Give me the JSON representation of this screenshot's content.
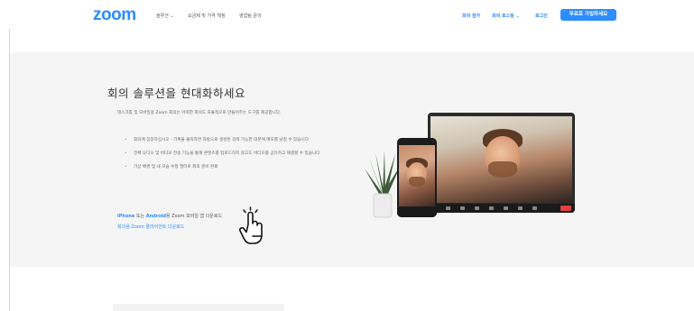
{
  "header": {
    "logo": "zoom",
    "nav": [
      "솔루션 ⌄",
      "요금제 및 가격 책정",
      "영업팀 문의"
    ],
    "nav_right": [
      "회의 참가",
      "회의 호스팅 ⌄",
      "로그인"
    ],
    "signup": "무료로 가입하세요"
  },
  "hero": {
    "title": "회의 솔루션을 현대화하세요",
    "description": "데스크톱 및 모바일용 Zoom 회의는 어떠한 회의도 효율적으로 만들어주는 도구를 제공합니다.",
    "bullets": [
      "회의에 집중하십시오 - 기록을 클릭하면 자동으로 생성된 검색 가능한 대본에 메모를 남길 수 있습니다",
      "전체 오디오 및 비디오 전송 기능을 통해 콘텐츠를 업로드하지 않고도 비디오를 공유하고 재생할 수 있습니다",
      "가상 배경 및 내 모습 수정 필터로 회의 준비 완료"
    ],
    "download": {
      "iphone": "iPhone",
      "or": " 또는 ",
      "android": "Android",
      "rest": "용 Zoom 모바일 앱 다운로드",
      "desktop": "회의용 Zoom 클라이언트 다운로드"
    }
  },
  "colors": {
    "brand": "#2d8cff",
    "hero_bg": "#f5f5f5"
  }
}
